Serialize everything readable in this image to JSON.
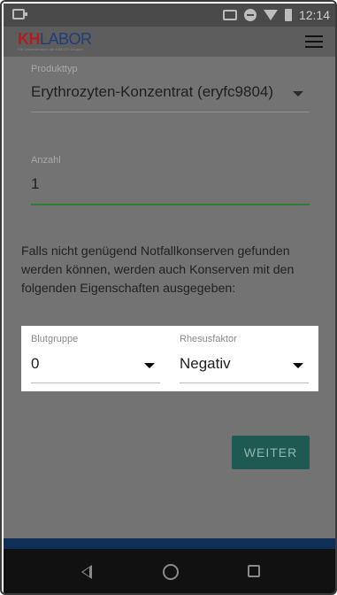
{
  "statusbar": {
    "time": "12:14"
  },
  "header": {
    "logo_kh": "KH",
    "logo_labor": "LABOR",
    "logo_sub": "Ein Unternehmen der AMEOS Gruppe"
  },
  "form": {
    "produkttyp": {
      "label": "Produkttyp",
      "value": "Erythrozyten-Konzentrat (eryfc9804)"
    },
    "anzahl": {
      "label": "Anzahl",
      "value": "1"
    }
  },
  "info_text": "Falls nicht genügend Notfallkonserven gefunden werden können, werden auch Konserven mit den folgenden Eigenschaften ausgegeben:",
  "card": {
    "blutgruppe": {
      "label": "Blutgruppe",
      "value": "0"
    },
    "rhesusfaktor": {
      "label": "Rhesusfaktor",
      "value": "Negativ"
    }
  },
  "actions": {
    "weiter_label": "WEITER"
  },
  "colors": {
    "accent_green": "#2E7D32",
    "button_teal": "#1f5a52",
    "logo_red": "#b71c1c",
    "logo_blue": "#1f3f7a"
  }
}
